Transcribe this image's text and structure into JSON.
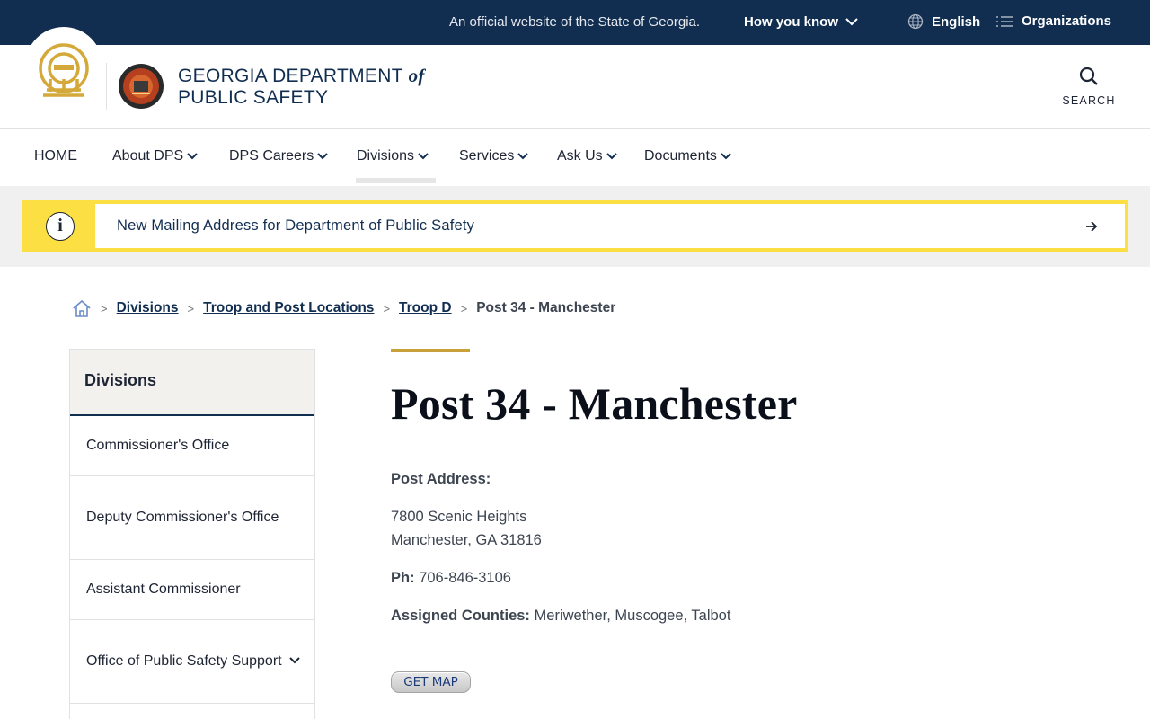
{
  "top_bar": {
    "official_text": "An official website of the State of Georgia.",
    "how_you_know": "How you know",
    "language": "English",
    "organizations": "Organizations"
  },
  "header": {
    "agency_name_line1": "GEORGIA DEPARTMENT",
    "agency_name_of": "of",
    "agency_name_line2": "PUBLIC SAFETY",
    "search_label": "SEARCH"
  },
  "nav": {
    "items": [
      {
        "label": "HOME",
        "dropdown": false
      },
      {
        "label": "About DPS",
        "dropdown": true
      },
      {
        "label": "DPS Careers",
        "dropdown": true
      },
      {
        "label": "Divisions",
        "dropdown": true,
        "active": true
      },
      {
        "label": "Services",
        "dropdown": true
      },
      {
        "label": "Ask Us",
        "dropdown": true
      },
      {
        "label": "Documents",
        "dropdown": true
      }
    ]
  },
  "alert": {
    "message": "New Mailing Address for Department of Public Safety",
    "icon": "info-icon"
  },
  "breadcrumb": {
    "home_icon": "home-icon",
    "links": [
      "Divisions",
      "Troop and Post Locations",
      "Troop D"
    ],
    "current": "Post 34 - Manchester"
  },
  "sidebar": {
    "heading": "Divisions",
    "items": [
      {
        "label": "Commissioner's Office",
        "expandable": false
      },
      {
        "label": "Deputy Commissioner's Office",
        "expandable": false
      },
      {
        "label": "Assistant Commissioner",
        "expandable": false
      },
      {
        "label": "Office of Public Safety Support",
        "expandable": true
      }
    ]
  },
  "main": {
    "title": "Post 34 - Manchester",
    "address_label": "Post Address:",
    "address_line1": "7800 Scenic Heights",
    "address_line2": "Manchester, GA 31816",
    "phone_label": "Ph:",
    "phone": "706-846-3106",
    "counties_label": "Assigned Counties:",
    "counties": "Meriwether, Muscogee, Talbot",
    "map_button": "GET MAP"
  },
  "colors": {
    "navy": "#112e51",
    "alert_yellow": "#fce043",
    "accent_gold": "#c9a13a"
  }
}
